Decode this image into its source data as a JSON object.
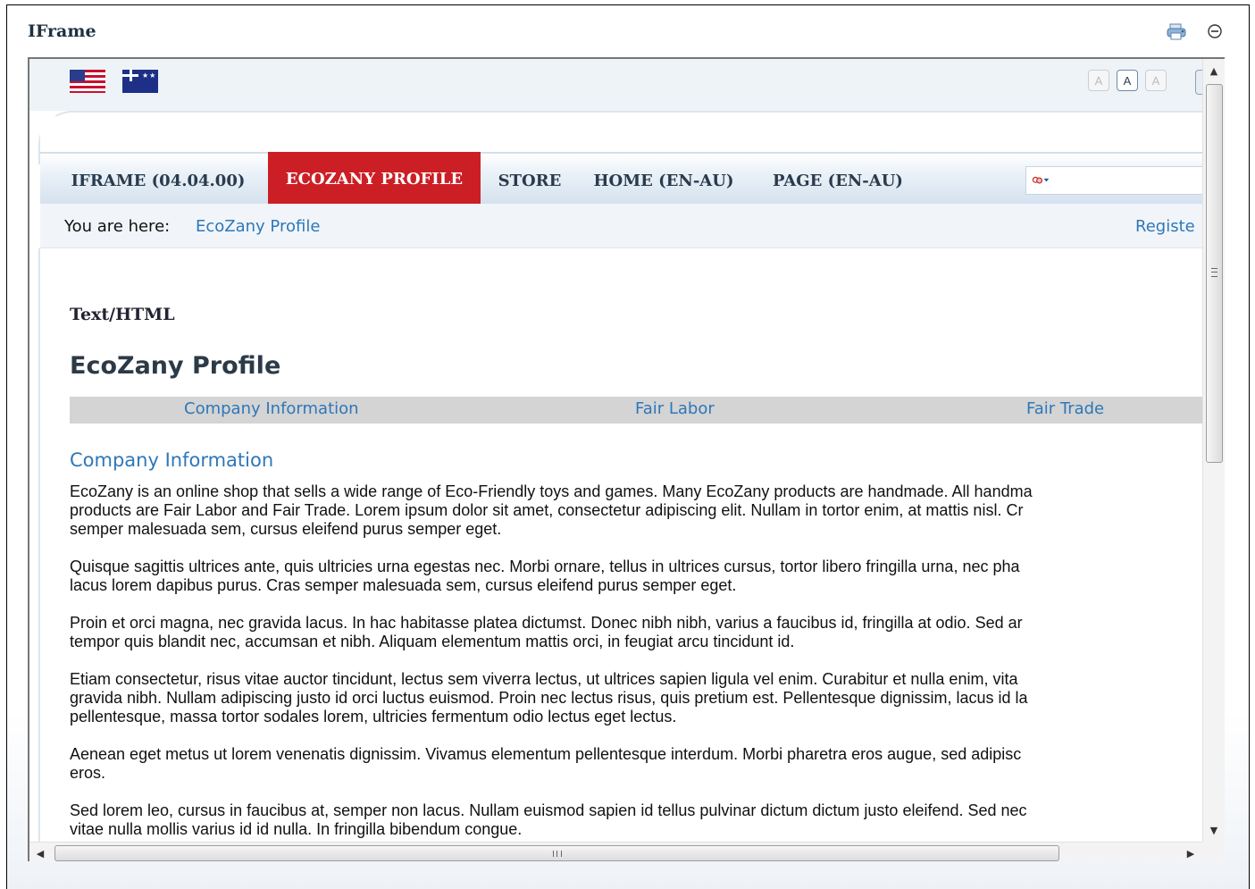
{
  "module": {
    "title": "IFrame",
    "print_icon": "print-icon",
    "minimize_icon": "minimize-icon"
  },
  "frame": {
    "languages": [
      {
        "name": "en-US",
        "icon": "us-flag-icon"
      },
      {
        "name": "en-AU",
        "icon": "au-flag-icon"
      }
    ],
    "font_sizes": [
      "A",
      "A",
      "A"
    ],
    "nav": [
      {
        "label": "IFRAME (04.04.00)",
        "active": false
      },
      {
        "label": "ECOZANY PROFILE",
        "active": true
      },
      {
        "label": "STORE",
        "active": false
      },
      {
        "label": "HOME (EN-AU)",
        "active": false
      },
      {
        "label": "PAGE (EN-AU)",
        "active": false
      }
    ],
    "search": {
      "icon": "search-provider-icon",
      "value": ""
    },
    "breadcrumb": {
      "label": "You are here:",
      "link": "EcoZany Profile"
    },
    "register": "Registe",
    "module_title": "Text/HTML",
    "page_heading": "EcoZany Profile",
    "tabs": [
      "Company Information",
      "Fair Labor",
      "Fair Trade"
    ],
    "section_title": "Company Information",
    "paragraphs": [
      [
        "EcoZany is an online shop that sells a wide range of Eco-Friendly toys and games. Many EcoZany products are handmade. All handma",
        "products are Fair Labor and Fair Trade. Lorem ipsum dolor sit amet, consectetur adipiscing elit. Nullam in tortor enim, at mattis nisl. Cr",
        "semper malesuada sem, cursus eleifend purus semper eget."
      ],
      [
        "Quisque sagittis ultrices ante, quis ultricies urna egestas nec. Morbi ornare, tellus in ultrices cursus, tortor libero fringilla urna, nec pha",
        "lacus lorem dapibus purus. Cras semper malesuada sem, cursus eleifend purus semper eget."
      ],
      [
        "Proin et orci magna, nec gravida lacus. In hac habitasse platea dictumst. Donec nibh nibh, varius a faucibus id, fringilla at odio. Sed ar",
        "tempor quis blandit nec, accumsan et nibh. Aliquam elementum mattis orci, in feugiat arcu tincidunt id."
      ],
      [
        "Etiam consectetur, risus vitae auctor tincidunt, lectus sem viverra lectus, ut ultrices sapien ligula vel enim. Curabitur et nulla enim, vita",
        "gravida nibh. Nullam adipiscing justo id orci luctus euismod. Proin nec lectus risus, quis pretium est. Pellentesque dignissim, lacus id la",
        "pellentesque, massa tortor sodales lorem, ultricies fermentum odio lectus eget lectus."
      ],
      [
        "Aenean eget metus ut lorem venenatis dignissim. Vivamus elementum pellentesque interdum. Morbi pharetra eros augue, sed adipisc",
        "eros."
      ],
      [
        "Sed lorem leo, cursus in faucibus at, semper non lacus. Nullam euismod sapien id tellus pulvinar dictum dictum justo eleifend. Sed nec",
        "vitae nulla mollis varius id id nulla. In fringilla bibendum congue."
      ]
    ]
  }
}
